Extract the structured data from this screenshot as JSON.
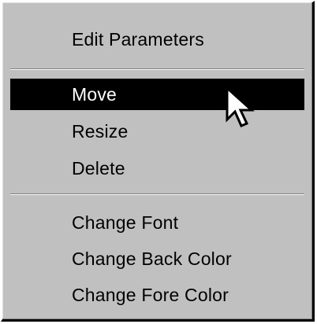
{
  "context_menu": {
    "items": [
      {
        "label": "Edit Parameters"
      },
      {
        "label": "Move",
        "highlighted": true
      },
      {
        "label": "Resize"
      },
      {
        "label": "Delete"
      },
      {
        "label": "Change Font"
      },
      {
        "label": "Change Back Color"
      },
      {
        "label": "Change Fore Color"
      }
    ]
  },
  "cursor": {
    "icon": "arrow-pointer-icon"
  },
  "colors": {
    "menu_background": "#c0c0c0",
    "highlight_background": "#000000",
    "highlight_text": "#ffffff",
    "text": "#000000"
  }
}
